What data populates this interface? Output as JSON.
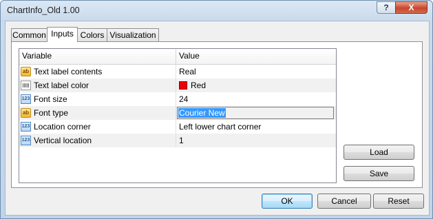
{
  "window": {
    "title": "ChartInfo_Old 1.00",
    "help_label": "?",
    "close_label": "X"
  },
  "tabs": [
    {
      "label": "Common"
    },
    {
      "label": "Inputs",
      "active": true
    },
    {
      "label": "Colors"
    },
    {
      "label": "Visualization"
    }
  ],
  "grid": {
    "columns": {
      "variable": "Variable",
      "value": "Value"
    },
    "rows": [
      {
        "icon": "ab-string-icon",
        "icon_text": "ab",
        "variable": "Text label contents",
        "value": "Real"
      },
      {
        "icon": "color-icon",
        "variable": "Text label color",
        "value": "Red",
        "swatch": "#ee0000"
      },
      {
        "icon": "numeric-icon",
        "icon_text": "123",
        "variable": "Font size",
        "value": "24"
      },
      {
        "icon": "ab-string-icon",
        "icon_text": "ab",
        "variable": "Font type",
        "value": "Courier New",
        "editing": true
      },
      {
        "icon": "numeric-icon",
        "icon_text": "123",
        "variable": "Location corner",
        "value": "Left lower chart corner"
      },
      {
        "icon": "numeric-icon",
        "icon_text": "123",
        "variable": "Vertical location",
        "value": "1"
      }
    ]
  },
  "side_buttons": {
    "load": "Load",
    "save": "Save"
  },
  "footer_buttons": {
    "ok": "OK",
    "cancel": "Cancel",
    "reset": "Reset"
  },
  "colors": {
    "selection": "#3399ff",
    "red_swatch": "#ee0000",
    "title_bar": "#c9daec"
  }
}
